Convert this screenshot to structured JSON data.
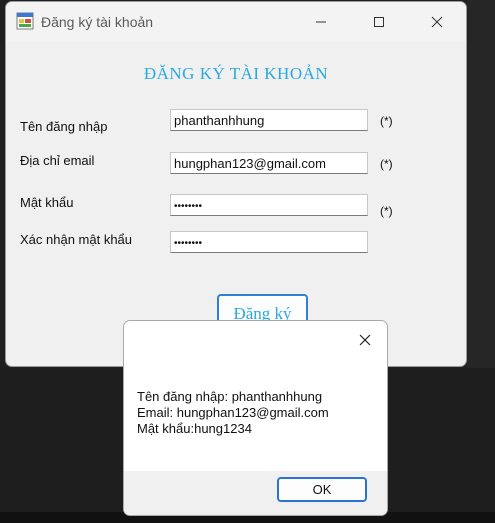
{
  "window": {
    "title": "Đăng ký tài khoản",
    "icon": "form-app-icon"
  },
  "form": {
    "heading": "ĐĂNG KÝ TÀI KHOẢN",
    "fields": [
      {
        "label": "Tên đăng nhập",
        "value": "phanthanhhung",
        "required_mark": "(*)"
      },
      {
        "label": "Địa chỉ email",
        "value": "hungphan123@gmail.com",
        "required_mark": "(*)"
      },
      {
        "label": "Mật khẩu",
        "value": "••••••••",
        "required_mark": "(*)"
      },
      {
        "label": "Xác nhận mật khẩu",
        "value": "••••••••"
      }
    ],
    "register_label": "Đăng ký"
  },
  "message_box": {
    "lines": [
      "Tên đăng nhập: phanthanhhung",
      "Email: hungphan123@gmail.com",
      "Mật khẩu:hung1234"
    ],
    "ok_label": "OK"
  },
  "colors": {
    "accent": "#2aa9e0",
    "button_border": "#2f7fd6"
  }
}
